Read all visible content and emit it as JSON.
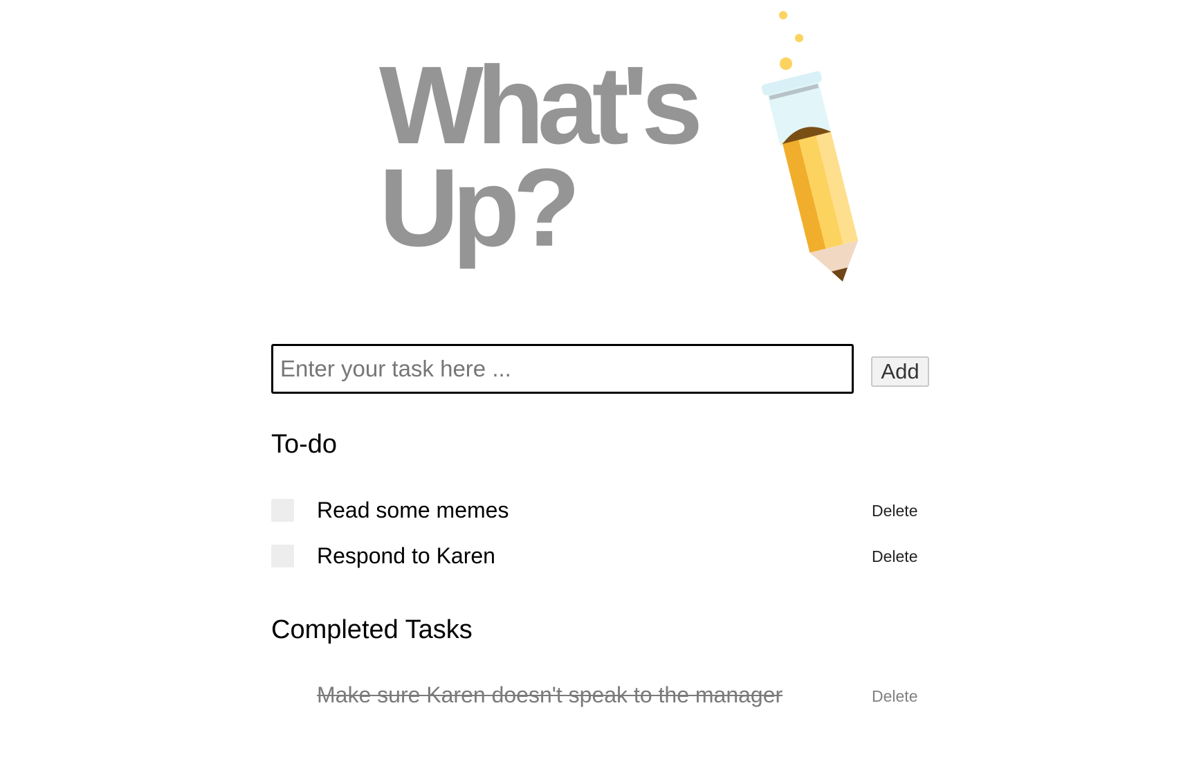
{
  "logo": {
    "title_line1": "What's",
    "title_line2": "Up?",
    "title_color": "#959595",
    "illustration": "pencil-test-tube-icon"
  },
  "task_input": {
    "placeholder": "Enter your task here ...",
    "value": ""
  },
  "add_button": {
    "label": "Add"
  },
  "todo": {
    "heading": "To-do",
    "items": [
      {
        "text": "Read some memes",
        "checked": false,
        "delete_label": "Delete"
      },
      {
        "text": "Respond to Karen",
        "checked": false,
        "delete_label": "Delete"
      }
    ]
  },
  "completed": {
    "heading": "Completed Tasks",
    "items": [
      {
        "text": "Make sure Karen doesn't speak to the manager",
        "checked": true,
        "delete_label": "Delete"
      }
    ]
  },
  "colors": {
    "logo_gray": "#959595",
    "pencil_yellow": "#fdd35f",
    "checkbox_bg": "#ededed",
    "completed_text": "#7a7a7a"
  }
}
